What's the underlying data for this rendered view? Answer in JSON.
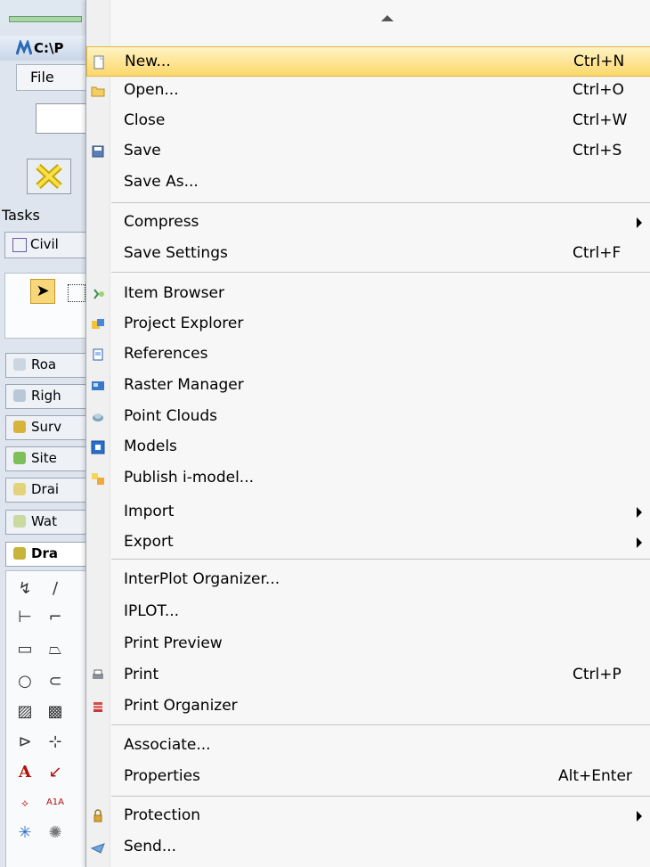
{
  "background_app": {
    "title": "C:\\P",
    "menu_file": "File",
    "tasks_label": "Tasks",
    "task_tab": "Civil",
    "side_items": [
      "Roa",
      "Righ",
      "Surv",
      "Site",
      "Drai",
      "Wat",
      "Dra"
    ]
  },
  "menu": {
    "items": [
      {
        "label": "New...",
        "shortcut": "Ctrl+N",
        "icon": "new-document-icon"
      },
      {
        "label": "Open...",
        "shortcut": "Ctrl+O",
        "icon": "open-folder-icon"
      },
      {
        "label": "Close",
        "shortcut": "Ctrl+W",
        "icon": ""
      },
      {
        "label": "Save",
        "shortcut": "Ctrl+S",
        "icon": "save-disk-icon"
      },
      {
        "label": "Save As...",
        "shortcut": "",
        "icon": ""
      },
      {
        "label": "Compress",
        "shortcut": "",
        "icon": "",
        "submenu": true
      },
      {
        "label": "Save Settings",
        "shortcut": "Ctrl+F",
        "icon": ""
      },
      {
        "label": "Item Browser",
        "shortcut": "",
        "icon": "item-browser-icon"
      },
      {
        "label": "Project Explorer",
        "shortcut": "",
        "icon": "project-explorer-icon"
      },
      {
        "label": "References",
        "shortcut": "",
        "icon": "references-icon"
      },
      {
        "label": "Raster Manager",
        "shortcut": "",
        "icon": "raster-manager-icon"
      },
      {
        "label": "Point Clouds",
        "shortcut": "",
        "icon": "point-clouds-icon"
      },
      {
        "label": "Models",
        "shortcut": "",
        "icon": "models-icon"
      },
      {
        "label": "Publish i-model...",
        "shortcut": "",
        "icon": "publish-imodel-icon"
      },
      {
        "label": "Import",
        "shortcut": "",
        "icon": "",
        "submenu": true
      },
      {
        "label": "Export",
        "shortcut": "",
        "icon": "",
        "submenu": true
      },
      {
        "label": "InterPlot Organizer...",
        "shortcut": "",
        "icon": ""
      },
      {
        "label": "IPLOT...",
        "shortcut": "",
        "icon": ""
      },
      {
        "label": "Print Preview",
        "shortcut": "",
        "icon": ""
      },
      {
        "label": "Print",
        "shortcut": "Ctrl+P",
        "icon": "printer-icon"
      },
      {
        "label": "Print Organizer",
        "shortcut": "",
        "icon": "print-organizer-icon"
      },
      {
        "label": "Associate...",
        "shortcut": "",
        "icon": ""
      },
      {
        "label": "Properties",
        "shortcut": "Alt+Enter",
        "icon": ""
      },
      {
        "label": "Protection",
        "shortcut": "",
        "icon": "lock-icon",
        "submenu": true
      },
      {
        "label": "Send...",
        "shortcut": "",
        "icon": "send-mail-icon"
      }
    ]
  },
  "colors": {
    "highlight": "#fcd86a",
    "menu_bg": "#f7f7f7",
    "separator": "#c5c5c5"
  }
}
